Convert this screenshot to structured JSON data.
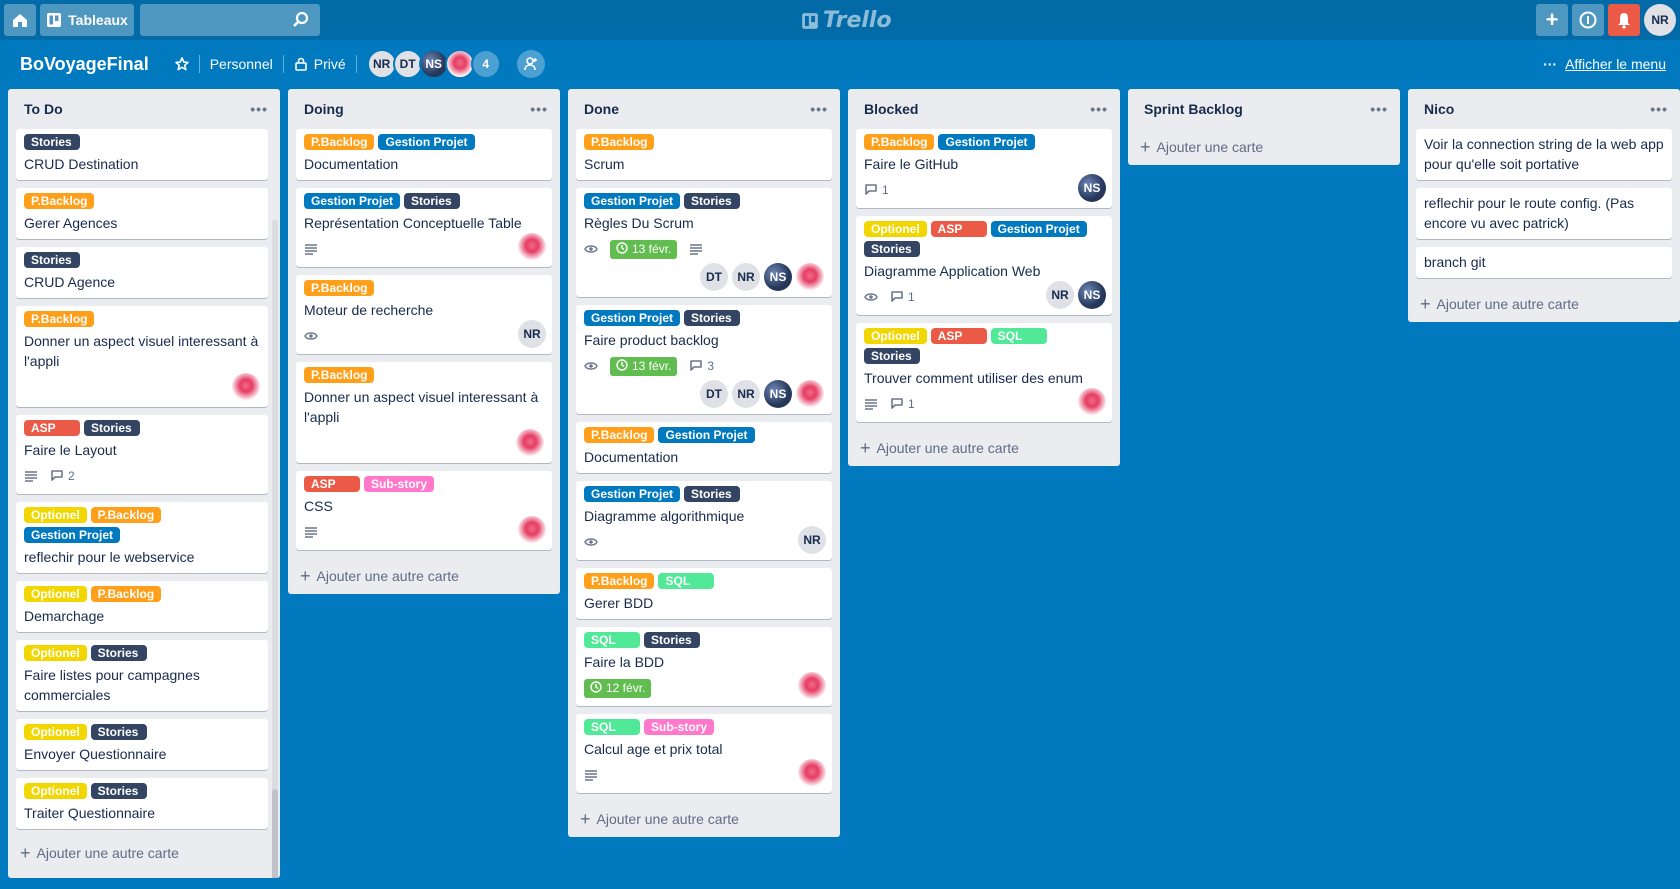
{
  "topbar": {
    "boards_label": "Tableaux",
    "logo": "Trello",
    "user_initials": "NR"
  },
  "board": {
    "name": "BoVoyageFinal",
    "team": "Personnel",
    "visibility": "Privé",
    "members": [
      "NR",
      "DT",
      "NS"
    ],
    "extra_members": "4",
    "menu_label": "Afficher le menu"
  },
  "lists": [
    {
      "name": "To Do",
      "add_label": "Ajouter une autre carte",
      "cards": [
        {
          "labels": [
            {
              "text": "Stories",
              "color": "navy"
            }
          ],
          "title": "CRUD Destination"
        },
        {
          "labels": [
            {
              "text": "P.Backlog",
              "color": "orange"
            }
          ],
          "title": "Gerer Agences"
        },
        {
          "labels": [
            {
              "text": "Stories",
              "color": "navy"
            }
          ],
          "title": "CRUD Agence"
        },
        {
          "labels": [
            {
              "text": "P.Backlog",
              "color": "orange"
            }
          ],
          "title": "Donner un aspect visuel interessant à l'appli",
          "members": [
            "rose"
          ]
        },
        {
          "labels": [
            {
              "text": "ASP",
              "color": "red"
            },
            {
              "text": "Stories",
              "color": "navy"
            }
          ],
          "title": "Faire le Layout",
          "badges": {
            "desc": true,
            "comments": "2"
          }
        },
        {
          "labels": [
            {
              "text": "Optionel",
              "color": "yellow"
            },
            {
              "text": "P.Backlog",
              "color": "orange"
            },
            {
              "text": "Gestion Projet",
              "color": "blue"
            }
          ],
          "title": "reflechir pour le webservice"
        },
        {
          "labels": [
            {
              "text": "Optionel",
              "color": "yellow"
            },
            {
              "text": "P.Backlog",
              "color": "orange"
            }
          ],
          "title": "Demarchage"
        },
        {
          "labels": [
            {
              "text": "Optionel",
              "color": "yellow"
            },
            {
              "text": "Stories",
              "color": "navy"
            }
          ],
          "title": "Faire listes pour campagnes commerciales"
        },
        {
          "labels": [
            {
              "text": "Optionel",
              "color": "yellow"
            },
            {
              "text": "Stories",
              "color": "navy"
            }
          ],
          "title": "Envoyer Questionnaire"
        },
        {
          "labels": [
            {
              "text": "Optionel",
              "color": "yellow"
            },
            {
              "text": "Stories",
              "color": "navy"
            }
          ],
          "title": "Traiter Questionnaire"
        }
      ]
    },
    {
      "name": "Doing",
      "add_label": "Ajouter une autre carte",
      "cards": [
        {
          "labels": [
            {
              "text": "P.Backlog",
              "color": "orange"
            },
            {
              "text": "Gestion Projet",
              "color": "blue"
            }
          ],
          "title": "Documentation"
        },
        {
          "labels": [
            {
              "text": "Gestion Projet",
              "color": "blue"
            },
            {
              "text": "Stories",
              "color": "navy"
            }
          ],
          "title": "Représentation Conceptuelle Table",
          "badges": {
            "desc": true
          },
          "members": [
            "rose"
          ]
        },
        {
          "labels": [
            {
              "text": "P.Backlog",
              "color": "orange"
            }
          ],
          "title": "Moteur de recherche",
          "badges": {
            "watch": true
          },
          "members": [
            "NR"
          ]
        },
        {
          "labels": [
            {
              "text": "P.Backlog",
              "color": "orange"
            }
          ],
          "title": "Donner un aspect visuel interessant à l'appli",
          "members": [
            "rose"
          ]
        },
        {
          "labels": [
            {
              "text": "ASP",
              "color": "red"
            },
            {
              "text": "Sub-story",
              "color": "pink"
            }
          ],
          "title": "CSS",
          "badges": {
            "desc": true
          },
          "members": [
            "rose"
          ]
        }
      ]
    },
    {
      "name": "Done",
      "add_label": "Ajouter une autre carte",
      "cards": [
        {
          "labels": [
            {
              "text": "P.Backlog",
              "color": "orange"
            }
          ],
          "title": "Scrum"
        },
        {
          "labels": [
            {
              "text": "Gestion Projet",
              "color": "blue"
            },
            {
              "text": "Stories",
              "color": "navy"
            }
          ],
          "title": "Règles Du Scrum",
          "badges": {
            "watch": true,
            "due": "13 févr.",
            "desc": true
          },
          "members": [
            "DT",
            "NR",
            "NS",
            "rose"
          ],
          "member_row": true
        },
        {
          "labels": [
            {
              "text": "Gestion Projet",
              "color": "blue"
            },
            {
              "text": "Stories",
              "color": "navy"
            }
          ],
          "title": "Faire product backlog",
          "badges": {
            "watch": true,
            "due": "13 févr.",
            "comments": "3"
          },
          "members": [
            "DT",
            "NR",
            "NS",
            "rose"
          ],
          "member_row": true
        },
        {
          "labels": [
            {
              "text": "P.Backlog",
              "color": "orange"
            },
            {
              "text": "Gestion Projet",
              "color": "blue"
            }
          ],
          "title": "Documentation"
        },
        {
          "labels": [
            {
              "text": "Gestion Projet",
              "color": "blue"
            },
            {
              "text": "Stories",
              "color": "navy"
            }
          ],
          "title": "Diagramme algorithmique",
          "badges": {
            "watch": true
          },
          "members": [
            "NR"
          ]
        },
        {
          "labels": [
            {
              "text": "P.Backlog",
              "color": "orange"
            },
            {
              "text": "SQL",
              "color": "sky"
            }
          ],
          "title": "Gerer BDD"
        },
        {
          "labels": [
            {
              "text": "SQL",
              "color": "sky"
            },
            {
              "text": "Stories",
              "color": "navy"
            }
          ],
          "title": "Faire la BDD",
          "badges": {
            "due": "12 févr."
          },
          "members": [
            "rose"
          ]
        },
        {
          "labels": [
            {
              "text": "SQL",
              "color": "sky"
            },
            {
              "text": "Sub-story",
              "color": "pink"
            }
          ],
          "title": "Calcul age et prix total",
          "badges": {
            "desc": true
          },
          "members": [
            "rose"
          ]
        }
      ]
    },
    {
      "name": "Blocked",
      "add_label": "Ajouter une autre carte",
      "cards": [
        {
          "labels": [
            {
              "text": "P.Backlog",
              "color": "orange"
            },
            {
              "text": "Gestion Projet",
              "color": "blue"
            }
          ],
          "title": "Faire le GitHub",
          "badges": {
            "comments": "1"
          },
          "members": [
            "NS"
          ]
        },
        {
          "labels": [
            {
              "text": "Optionel",
              "color": "yellow"
            },
            {
              "text": "ASP",
              "color": "red"
            },
            {
              "text": "Gestion Projet",
              "color": "blue"
            },
            {
              "text": "Stories",
              "color": "navy"
            }
          ],
          "title": "Diagramme Application Web",
          "badges": {
            "watch": true,
            "comments": "1"
          },
          "members": [
            "NR",
            "NS"
          ]
        },
        {
          "labels": [
            {
              "text": "Optionel",
              "color": "yellow"
            },
            {
              "text": "ASP",
              "color": "red"
            },
            {
              "text": "SQL",
              "color": "sky"
            },
            {
              "text": "Stories",
              "color": "navy"
            }
          ],
          "title": "Trouver comment utiliser des enum",
          "badges": {
            "desc": true,
            "comments": "1"
          },
          "members": [
            "rose"
          ]
        }
      ]
    },
    {
      "name": "Sprint Backlog",
      "add_label": "Ajouter une carte",
      "cards": []
    },
    {
      "name": "Nico",
      "add_label": "Ajouter une autre carte",
      "cards": [
        {
          "labels": [],
          "title": "Voir la connection string de la web app pour qu'elle soit portative"
        },
        {
          "labels": [],
          "title": "reflechir pour le route config. (Pas encore vu avec patrick)"
        },
        {
          "labels": [],
          "title": "branch git"
        }
      ]
    }
  ]
}
